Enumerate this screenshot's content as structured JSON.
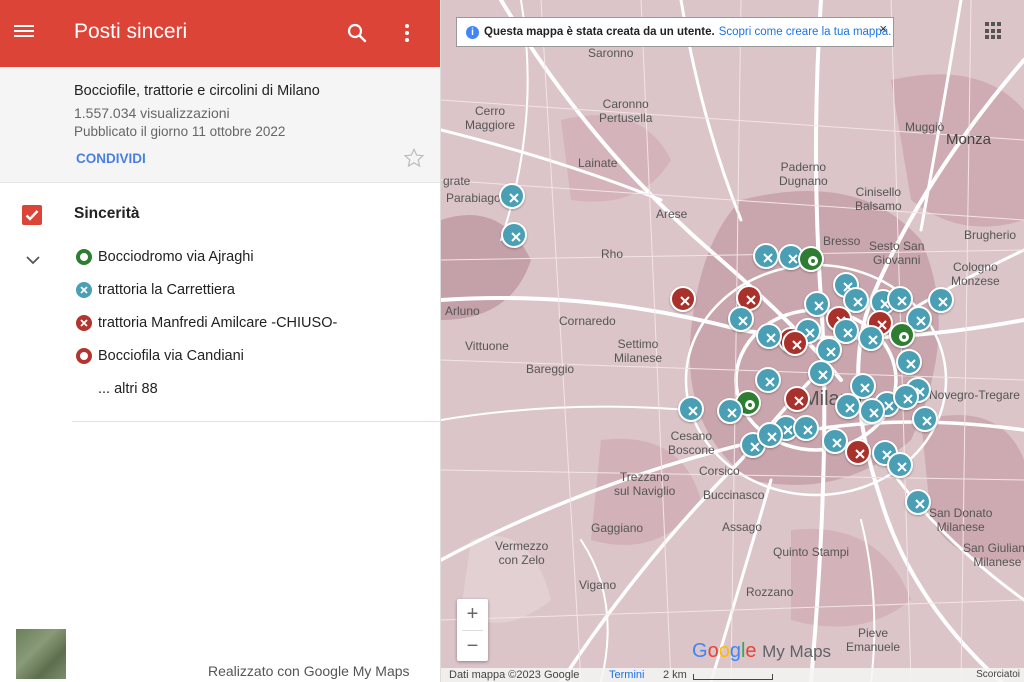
{
  "app": {
    "title": "Posti sinceri"
  },
  "info": {
    "map_title": "Bocciofile, trattorie e circolini di Milano",
    "views": "1.557.034 visualizzazioni",
    "published": "Pubblicato il giorno 11 ottobre 2022",
    "share_label": "CONDIVIDI"
  },
  "layer": {
    "name": "Sincerità",
    "places": [
      {
        "label": "Bocciodromo via Ajraghi",
        "type": "bocciodromo",
        "color": "#2e7d32"
      },
      {
        "label": "trattoria la Carrettiera",
        "type": "trattoria",
        "color": "#4a9fb5"
      },
      {
        "label": "trattoria Manfredi Amilcare -CHIUSO-",
        "type": "trattoria",
        "color": "#b2352f"
      },
      {
        "label": "Bocciofila via Candiani",
        "type": "bocciofila",
        "color": "#b2352f"
      }
    ],
    "more_label": "... altri 88"
  },
  "footer": {
    "made_with": "Realizzato con Google My Maps"
  },
  "banner": {
    "text": "Questa mappa è stata creata da un utente.",
    "link": "Scopri come creare la tua mappa.",
    "close": "×"
  },
  "map": {
    "labels": [
      {
        "text": "Saronno"
      },
      {
        "text": "Caronno\nPertusella"
      },
      {
        "text": "Cerro\nMaggiore"
      },
      {
        "text": "Lainate"
      },
      {
        "text": "Paderno\nDugnano"
      },
      {
        "text": "Muggiò"
      },
      {
        "text": "Monza"
      },
      {
        "text": "Cinisello\nBalsamo"
      },
      {
        "text": "Arese"
      },
      {
        "text": "Parabiago"
      },
      {
        "text": "Bresso"
      },
      {
        "text": "Sesto San\nGiovanni"
      },
      {
        "text": "Brugherio"
      },
      {
        "text": "Cologno\nMonzese"
      },
      {
        "text": "Rho"
      },
      {
        "text": "Arluno"
      },
      {
        "text": "Cornaredo"
      },
      {
        "text": "Vittuone"
      },
      {
        "text": "Settimo\nMilanese"
      },
      {
        "text": "Bareggio"
      },
      {
        "text": "Cesano\nBoscone"
      },
      {
        "text": "Corsico"
      },
      {
        "text": "Trezzano\nsul Naviglio"
      },
      {
        "text": "Buccinasco"
      },
      {
        "text": "Gaggiano"
      },
      {
        "text": "Assago"
      },
      {
        "text": "Vermezzo\ncon Zelo"
      },
      {
        "text": "Quinto Stampi"
      },
      {
        "text": "Vigano"
      },
      {
        "text": "Rozzano"
      },
      {
        "text": "Pieve\nEmanuele"
      },
      {
        "text": "San Donato\nMilanese"
      },
      {
        "text": "San Giuliano\nMilanese"
      },
      {
        "text": "Novegro-Tregare"
      },
      {
        "text": "Milano"
      },
      {
        "text": "grate"
      }
    ],
    "logo": {
      "brand": "Google",
      "product": "My Maps"
    },
    "attribution": "Dati mappa ©2023 Google",
    "terms": "Termini",
    "scale": "2 km",
    "shortcuts": "Scorciatoi",
    "zoom_in": "+",
    "zoom_out": "−",
    "pins": [
      {
        "type": "teal"
      },
      {
        "type": "teal"
      },
      {
        "type": "red"
      },
      {
        "type": "red"
      },
      {
        "type": "teal"
      },
      {
        "type": "teal"
      },
      {
        "type": "green"
      },
      {
        "type": "teal"
      },
      {
        "type": "teal"
      },
      {
        "type": "teal"
      },
      {
        "type": "red"
      },
      {
        "type": "teal"
      },
      {
        "type": "teal"
      },
      {
        "type": "teal"
      },
      {
        "type": "red"
      },
      {
        "type": "teal"
      },
      {
        "type": "teal"
      },
      {
        "type": "red"
      },
      {
        "type": "teal"
      },
      {
        "type": "teal"
      },
      {
        "type": "green"
      },
      {
        "type": "teal"
      },
      {
        "type": "teal"
      },
      {
        "type": "red"
      },
      {
        "type": "teal"
      },
      {
        "type": "teal"
      },
      {
        "type": "teal"
      },
      {
        "type": "teal"
      },
      {
        "type": "teal"
      },
      {
        "type": "teal"
      },
      {
        "type": "red"
      },
      {
        "type": "teal"
      },
      {
        "type": "teal"
      },
      {
        "type": "green"
      },
      {
        "type": "teal"
      },
      {
        "type": "teal"
      },
      {
        "type": "teal"
      },
      {
        "type": "teal"
      },
      {
        "type": "teal"
      },
      {
        "type": "teal"
      },
      {
        "type": "teal"
      },
      {
        "type": "teal"
      },
      {
        "type": "teal"
      },
      {
        "type": "red"
      },
      {
        "type": "teal"
      },
      {
        "type": "teal"
      },
      {
        "type": "teal"
      },
      {
        "type": "teal"
      }
    ]
  }
}
